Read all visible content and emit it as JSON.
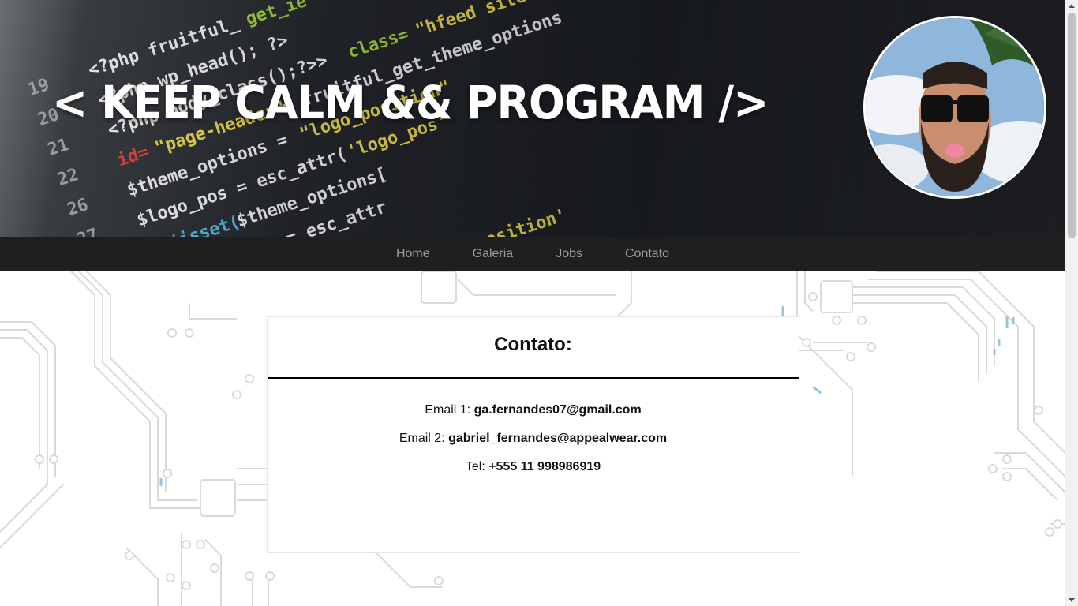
{
  "header": {
    "title": "< KEEP CALM && PROGRAM />",
    "background": "code-editor-photo",
    "avatar": "profile-photo"
  },
  "nav": {
    "items": [
      {
        "label": "Home"
      },
      {
        "label": "Galeria"
      },
      {
        "label": "Jobs"
      },
      {
        "label": "Contato"
      }
    ]
  },
  "contact": {
    "title": "Contato:",
    "email1_label": "Email 1:",
    "email1_value": "ga.fernandes07@gmail.com",
    "email2_label": "Email 2:",
    "email2_value": "gabriel_fernandes@appealwear.com",
    "tel_label": "Tel:",
    "tel_value": "+555 11 998986919"
  },
  "colors": {
    "navbar_bg": "#1f1f1f",
    "nav_text": "#9d9d9d",
    "circuit_lines": "#d8d8d8"
  }
}
